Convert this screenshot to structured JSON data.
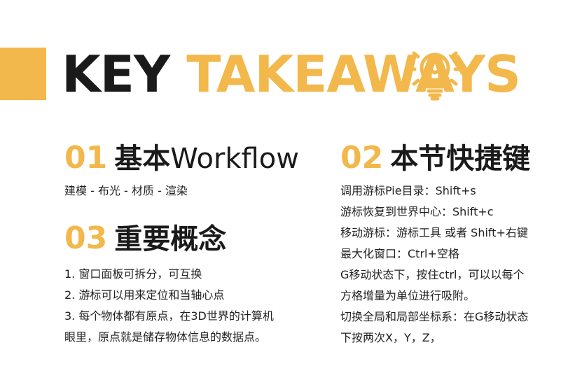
{
  "title": {
    "word1": "KEY",
    "word2": "TAKEAWAYS"
  },
  "colors": {
    "accent": "#f2b84b",
    "text_dark": "#1a1a1a",
    "background": "#ffffff"
  },
  "icon": "lightbulb-icon",
  "sections": [
    {
      "number": "01",
      "title_cn": "基本",
      "title_en": "Workflow",
      "lines": [
        "建模 - 布光 - 材质 - 渲染"
      ]
    },
    {
      "number": "03",
      "title_cn": "重要概念",
      "lines": [
        "1. 窗口面板可拆分，可互换",
        "2. 游标可以用来定位和当轴心点",
        "3. 每个物体都有原点，在3D世界的计算机",
        "眼里，原点就是储存物体信息的数据点。"
      ]
    },
    {
      "number": "02",
      "title_cn": "本节快捷键",
      "lines": [
        "调用游标Pie目录：Shift+s",
        "游标恢复到世界中心：Shift+c",
        "移动游标：游标工具 或者 Shift+右键",
        "最大化窗口：Ctrl+空格",
        "G移动状态下，按住ctrl，可以以每个",
        "方格增量为单位进行吸附。",
        "切换全局和局部坐标系：在G移动状态",
        "下按两次X，Y，Z，"
      ]
    }
  ]
}
